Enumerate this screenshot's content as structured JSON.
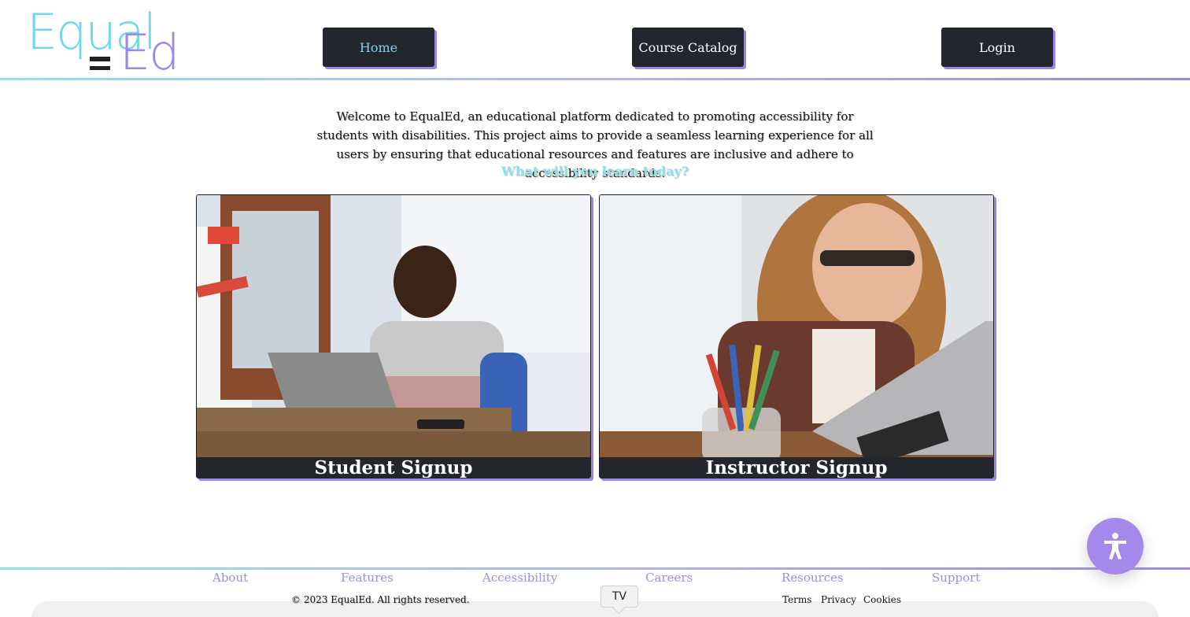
{
  "header": {
    "logo": {
      "part1": "Equal",
      "part2": "Ed"
    },
    "nav": {
      "home": "Home",
      "catalog": "Course Catalog",
      "login": "Login"
    }
  },
  "intro": {
    "text": "Welcome to EqualEd, an educational platform dedicated to promoting accessibility for students with disabilities. This project aims to provide a seamless learning experience for all users by ensuring that educational resources and features are inclusive and adhere to accessibility standards.",
    "tagline": "What will you learn today?"
  },
  "cards": {
    "student": "Student Signup",
    "instructor": "Instructor Signup"
  },
  "footer": {
    "links": {
      "about": "About",
      "features": "Features",
      "accessibility": "Accessibility",
      "careers": "Careers",
      "resources": "Resources",
      "support": "Support"
    },
    "copyright": "© 2023 EqualEd. All rights reserved.",
    "legal": {
      "terms": "Terms",
      "privacy": "Privacy",
      "cookies": "Cookies"
    }
  },
  "tooltip": "TV",
  "colors": {
    "accent_cyan": "#8fe3f0",
    "accent_purple": "#9d86e8",
    "dark": "#23262d"
  },
  "icons": {
    "accessibility": "accessibility-person-icon"
  }
}
